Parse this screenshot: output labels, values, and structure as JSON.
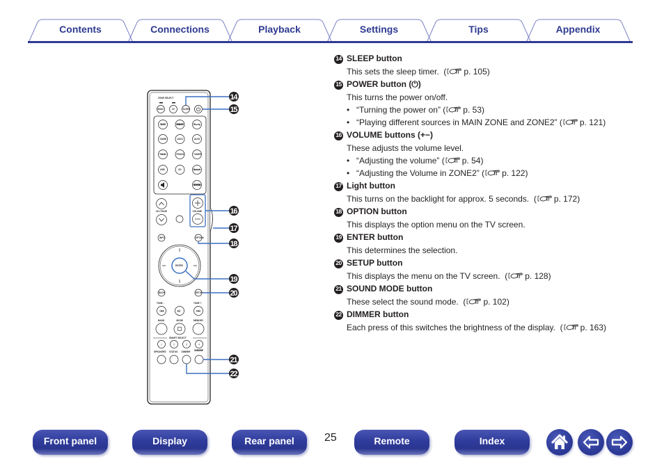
{
  "tabs": [
    {
      "label": "Contents"
    },
    {
      "label": "Connections"
    },
    {
      "label": "Playback"
    },
    {
      "label": "Settings"
    },
    {
      "label": "Tips"
    },
    {
      "label": "Appendix"
    }
  ],
  "remote": {
    "zone_select_label": "ZONE SELECT",
    "buttons": {
      "main": "MAIN",
      "z2": "Z2",
      "sleep": "SLEEP",
      "power": "⏻",
      "cbl_sat": "CBL/SAT",
      "media_player": "MEDIA PLAYER",
      "bluray": "Blu-ray",
      "game": "GAME",
      "aux1": "AUX1",
      "aux2": "AUX2",
      "tv_audio": "TV AUDIO",
      "phono": "PHONO",
      "tuner": "TUNER",
      "usb": "USB",
      "cd": "CD",
      "bluetooth": "Bluetooth",
      "mute": "🔇",
      "internet_radio": "INTERNET RADIO",
      "ch_page": "CH / PAGE",
      "volume": "VOLUME",
      "info": "INFO",
      "option": "OPTION",
      "enter": "ENTER",
      "back": "BACK",
      "setup": "SETUP",
      "tune_minus": "TUNE -",
      "tune_plus": "TUNE +",
      "band": "BAND",
      "mode": "MODE",
      "memory": "MEMORY",
      "smart_select": "SMART SELECT",
      "speakers": "SPEAKERS",
      "status": "STATUS",
      "dimmer": "DIMMER",
      "sound_mode": "SOUND MODE",
      "smart": [
        "1",
        "2",
        "3",
        "4"
      ]
    },
    "callouts": [
      "14",
      "15",
      "16",
      "17",
      "18",
      "19",
      "20",
      "21",
      "22"
    ]
  },
  "items": [
    {
      "num": "14",
      "title": "SLEEP button",
      "text": "This sets the sleep timer.",
      "ref": "p. 105",
      "bullets": []
    },
    {
      "num": "15",
      "title": "POWER button (⏻)",
      "text": "This turns the power on/off.",
      "ref": "",
      "bullets": [
        {
          "text": "“Turning the power on”",
          "ref": "p. 53"
        },
        {
          "text": "“Playing different sources in MAIN ZONE and ZONE2”",
          "ref": "p. 121"
        }
      ]
    },
    {
      "num": "16",
      "title": "VOLUME buttons (+−)",
      "text": "These adjusts the volume level.",
      "ref": "",
      "bullets": [
        {
          "text": "“Adjusting the volume”",
          "ref": "p. 54"
        },
        {
          "text": "“Adjusting the Volume in ZONE2”",
          "ref": "p. 122"
        }
      ]
    },
    {
      "num": "17",
      "title": "Light button",
      "text": "This turns on the backlight for approx. 5 seconds.",
      "ref": "p. 172",
      "bullets": []
    },
    {
      "num": "18",
      "title": "OPTION button",
      "text": "This displays the option menu on the TV screen.",
      "ref": "",
      "bullets": []
    },
    {
      "num": "19",
      "title": "ENTER button",
      "text": "This determines the selection.",
      "ref": "",
      "bullets": []
    },
    {
      "num": "20",
      "title": "SETUP button",
      "text": "This displays the menu on the TV screen.",
      "ref": "p. 128",
      "bullets": []
    },
    {
      "num": "21",
      "title": "SOUND MODE button",
      "text": "These select the sound mode.",
      "ref": "p. 102",
      "bullets": []
    },
    {
      "num": "22",
      "title": "DIMMER button",
      "text": "Each press of this switches the brightness of the display.",
      "ref": "p. 163",
      "bullets": []
    }
  ],
  "bottom_nav": {
    "buttons": [
      {
        "label": "Front panel"
      },
      {
        "label": "Display"
      },
      {
        "label": "Rear panel"
      },
      {
        "label": "Remote"
      },
      {
        "label": "Index"
      }
    ],
    "page_number": "25",
    "icons": {
      "home": "home-icon",
      "back": "arrow-left-icon",
      "forward": "arrow-right-icon"
    }
  },
  "colors": {
    "accent": "#2e3a91",
    "callout_line": "#3a6fc0",
    "text": "#231f20"
  }
}
